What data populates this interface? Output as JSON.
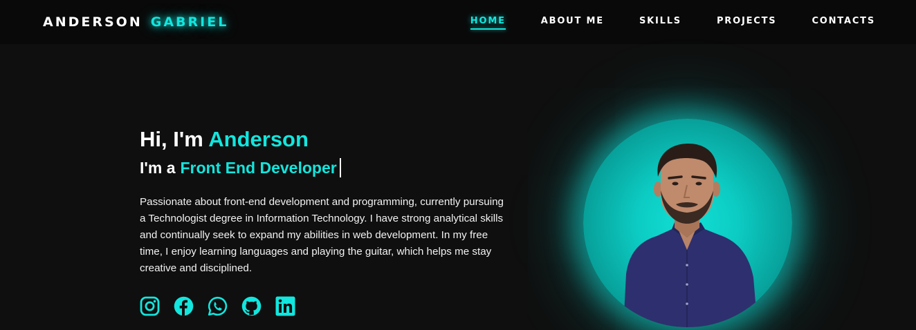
{
  "header": {
    "logo_first": "ANDERSON",
    "logo_last": "GABRIEL",
    "nav": [
      {
        "label": "HOME",
        "active": true
      },
      {
        "label": "ABOUT ME",
        "active": false
      },
      {
        "label": "SKILLS",
        "active": false
      },
      {
        "label": "PROJECTS",
        "active": false
      },
      {
        "label": "CONTACTS",
        "active": false
      }
    ]
  },
  "hero": {
    "greeting_prefix": "Hi, I'm",
    "greeting_name": "Anderson",
    "role_prefix": "I'm a",
    "role_title": "Front End Developer",
    "bio": "Passionate about front-end development and programming, currently pursuing a Technologist degree in Information Technology. I have strong analytical skills and continually seek to expand my abilities in web development. In my free time, I enjoy learning languages and playing the guitar, which helps me stay creative and disciplined."
  },
  "socials": [
    {
      "icon": "instagram-icon"
    },
    {
      "icon": "facebook-icon"
    },
    {
      "icon": "whatsapp-icon"
    },
    {
      "icon": "github-icon"
    },
    {
      "icon": "linkedin-icon"
    }
  ],
  "colors": {
    "accent": "#12e6de",
    "background": "#0f0f0f",
    "header_background": "#090909",
    "text": "#ffffff"
  }
}
